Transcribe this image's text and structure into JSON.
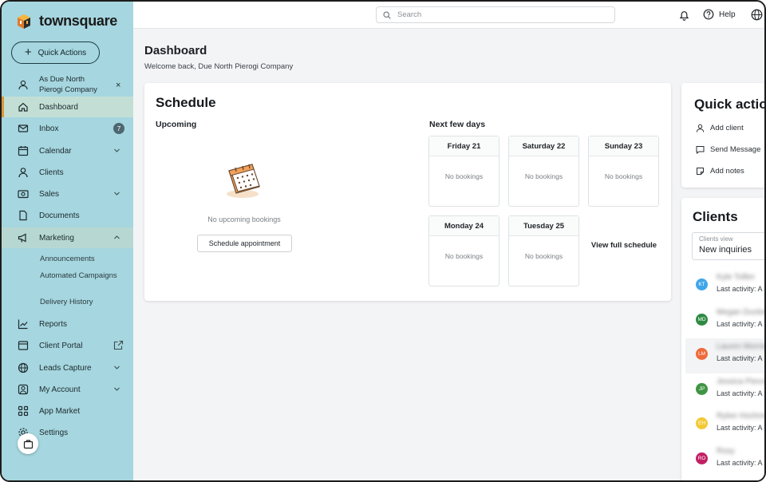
{
  "app": {
    "name": "townsquare"
  },
  "sidebar": {
    "quick_actions_label": "Quick Actions",
    "account_label": "As Due North Pierogi Company",
    "items": [
      {
        "label": "Dashboard",
        "icon": "home-icon"
      },
      {
        "label": "Inbox",
        "icon": "mail-icon",
        "badge": "7"
      },
      {
        "label": "Calendar",
        "icon": "calendar-icon"
      },
      {
        "label": "Clients",
        "icon": "user-icon"
      },
      {
        "label": "Sales",
        "icon": "money-icon"
      },
      {
        "label": "Documents",
        "icon": "document-icon"
      },
      {
        "label": "Marketing",
        "icon": "megaphone-icon"
      },
      {
        "label": "Reports",
        "icon": "chart-line-icon"
      },
      {
        "label": "Client Portal",
        "icon": "portal-icon"
      },
      {
        "label": "Leads Capture",
        "icon": "globe-icon"
      },
      {
        "label": "My Account",
        "icon": "account-icon"
      },
      {
        "label": "App Market",
        "icon": "apps-grid-icon"
      },
      {
        "label": "Settings",
        "icon": "gear-icon"
      }
    ],
    "marketing_sub": [
      "Announcements",
      "Automated Campaigns",
      "Delivery History"
    ]
  },
  "topbar": {
    "search_placeholder": "Search",
    "help_label": "Help"
  },
  "header": {
    "title": "Dashboard",
    "welcome": "Welcome back, Due North Pierogi Company"
  },
  "schedule": {
    "title": "Schedule",
    "upcoming_label": "Upcoming",
    "no_upcoming": "No upcoming bookings",
    "schedule_button": "Schedule appointment",
    "next_label": "Next few days",
    "days": [
      {
        "name": "Friday 21",
        "status": "No bookings"
      },
      {
        "name": "Saturday 22",
        "status": "No bookings"
      },
      {
        "name": "Sunday 23",
        "status": "No bookings"
      },
      {
        "name": "Monday 24",
        "status": "No bookings"
      },
      {
        "name": "Tuesday 25",
        "status": "No bookings"
      }
    ],
    "view_full": "View full schedule"
  },
  "quick_actions": {
    "title": "Quick actio",
    "items": [
      "Add client",
      "Send Message",
      "Add notes"
    ]
  },
  "clients": {
    "title": "Clients",
    "view_label": "Clients view",
    "view_value": "New inquiries",
    "rows": [
      {
        "initials": "KT",
        "name": "Kyle Tollier",
        "activity": "Last activity: A",
        "color": "#3fa6e8"
      },
      {
        "initials": "MD",
        "name": "Megan Duckett",
        "activity": "Last activity: A",
        "color": "#2e8a43"
      },
      {
        "initials": "LM",
        "name": "Lauren Morrison",
        "activity": "Last activity: A",
        "color": "#ee6a3a"
      },
      {
        "initials": "JP",
        "name": "Jessica Pierce",
        "activity": "Last activity: A",
        "color": "#3f9443"
      },
      {
        "initials": "EH",
        "name": "Rylee Hochman",
        "activity": "Last activity: A",
        "color": "#f3c935"
      },
      {
        "initials": "RO",
        "name": "Rosy",
        "activity": "Last activity: A",
        "color": "#c21f64"
      }
    ]
  }
}
